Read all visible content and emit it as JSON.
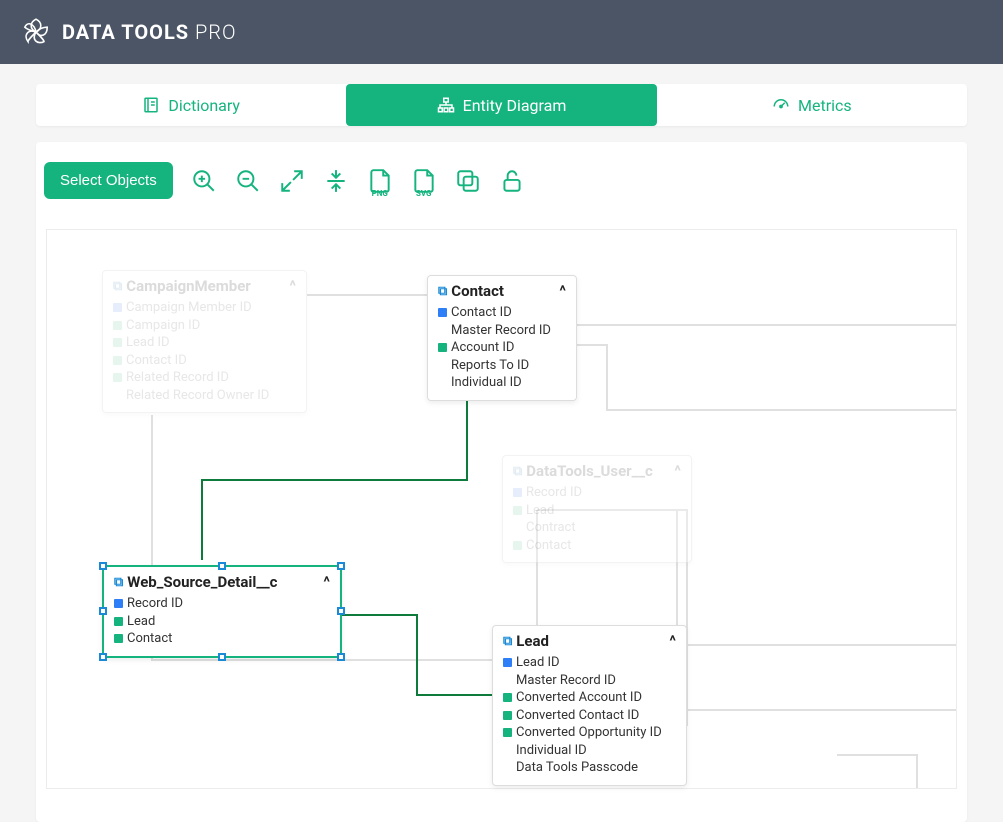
{
  "header": {
    "brand_bold": "DATA TOOLS",
    "brand_light": " PRO"
  },
  "tabs": {
    "dictionary": "Dictionary",
    "entity_diagram": "Entity Diagram",
    "metrics": "Metrics",
    "active": "entity_diagram"
  },
  "toolbar": {
    "select_objects": "Select Objects",
    "png_label": "PNG",
    "svg_label": "SVG"
  },
  "accent": "#15b47e",
  "entities": {
    "campaign_member": {
      "title": "CampaignMember",
      "dim": true,
      "fields": [
        {
          "marker": "blue",
          "label": "Campaign Member ID"
        },
        {
          "marker": "green",
          "label": "Campaign ID"
        },
        {
          "marker": "green",
          "label": "Lead ID"
        },
        {
          "marker": "green",
          "label": "Contact ID"
        },
        {
          "marker": "green",
          "label": "Related Record ID"
        },
        {
          "marker": "none",
          "label": "Related Record Owner ID"
        }
      ]
    },
    "contact": {
      "title": "Contact",
      "dim": false,
      "fields": [
        {
          "marker": "blue",
          "label": "Contact ID"
        },
        {
          "marker": "none",
          "label": "Master Record ID"
        },
        {
          "marker": "green",
          "label": "Account ID"
        },
        {
          "marker": "none",
          "label": "Reports To ID"
        },
        {
          "marker": "none",
          "label": "Individual ID"
        }
      ]
    },
    "datatools_user": {
      "title": "DataTools_User__c",
      "dim": true,
      "fields": [
        {
          "marker": "blue",
          "label": "Record ID"
        },
        {
          "marker": "green",
          "label": "Lead"
        },
        {
          "marker": "none",
          "label": "Contract"
        },
        {
          "marker": "green",
          "label": "Contact"
        }
      ]
    },
    "web_source_detail": {
      "title": "Web_Source_Detail__c",
      "dim": false,
      "selected": true,
      "fields": [
        {
          "marker": "blue",
          "label": "Record ID"
        },
        {
          "marker": "green",
          "label": "Lead"
        },
        {
          "marker": "green",
          "label": "Contact"
        }
      ]
    },
    "lead": {
      "title": "Lead",
      "dim": false,
      "fields": [
        {
          "marker": "blue",
          "label": "Lead ID"
        },
        {
          "marker": "none",
          "label": "Master Record ID"
        },
        {
          "marker": "green",
          "label": "Converted Account ID"
        },
        {
          "marker": "green",
          "label": "Converted Contact ID"
        },
        {
          "marker": "green",
          "label": "Converted Opportunity ID"
        },
        {
          "marker": "none",
          "label": "Individual ID"
        },
        {
          "marker": "none",
          "label": "Data Tools Passcode"
        }
      ]
    }
  }
}
